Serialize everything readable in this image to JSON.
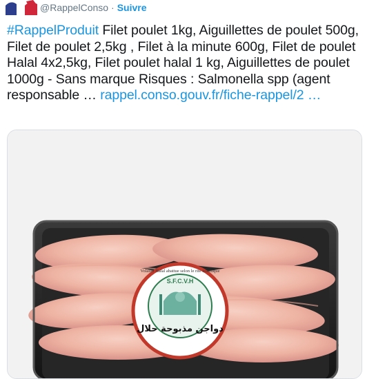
{
  "header": {
    "handle": "@RappelConso",
    "separator": "·",
    "follow_label": "Suivre"
  },
  "tweet": {
    "hashtag": "#RappelProduit",
    "body": " Filet poulet 1kg, Aiguillettes de poulet 500g, Filet de poulet 2,5kg , Filet à la minute 600g, Filet de poulet Halal 4x2,5kg, Filet poulet halal 1 kg, Aiguillettes de poulet 1000g - Sans marque Risques : Salmonella spp (agent responsable … ",
    "link": "rappel.conso.gouv.fr/fiche-rappel/2 …"
  },
  "media": {
    "sticker_ring_text": "Volaille Halal abattue selon le rite islamique",
    "sticker_top_text": "S.F.C.V.H",
    "sticker_arabic_text": "دواجن مذبوحة حلال",
    "icon_name": "mosque-icon",
    "colors": {
      "sticker_border": "#c0392b",
      "sticker_inner": "#2e7d4f",
      "link": "#1b95e0"
    }
  }
}
